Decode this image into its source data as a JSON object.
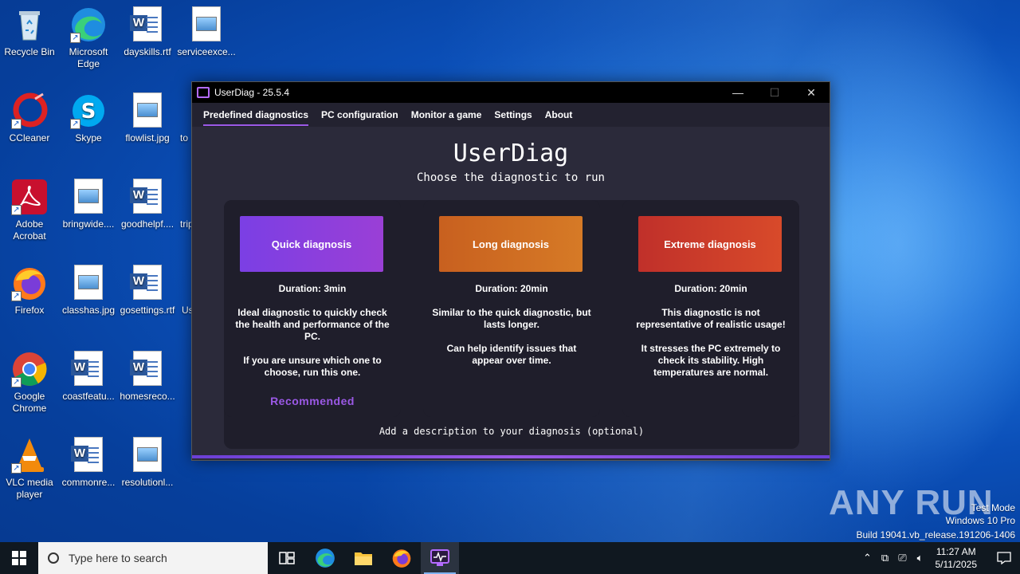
{
  "desktop": {
    "icons": [
      {
        "label": "Recycle Bin"
      },
      {
        "label": "Microsoft Edge"
      },
      {
        "label": "dayskills.rtf"
      },
      {
        "label": "serviceexce..."
      },
      {
        "label": "CCleaner"
      },
      {
        "label": "Skype"
      },
      {
        "label": "flowlist.jpg"
      },
      {
        "label": "to"
      },
      {
        "label": "Adobe Acrobat"
      },
      {
        "label": "bringwide...."
      },
      {
        "label": "goodhelpf...."
      },
      {
        "label": "trip"
      },
      {
        "label": "Firefox"
      },
      {
        "label": "classhas.jpg"
      },
      {
        "label": "gosettings.rtf"
      },
      {
        "label": "Us"
      },
      {
        "label": "Google Chrome"
      },
      {
        "label": "coastfeatu..."
      },
      {
        "label": "homesreco..."
      },
      {
        "label": "VLC media player"
      },
      {
        "label": "commonre..."
      },
      {
        "label": "resolutionl..."
      }
    ]
  },
  "window": {
    "title": "UserDiag - 25.5.4",
    "controls": {
      "minimize": "—",
      "maximize": "☐",
      "close": "✕"
    },
    "menu": [
      {
        "label": "Predefined diagnostics",
        "active": true
      },
      {
        "label": "PC configuration"
      },
      {
        "label": "Monitor a game"
      },
      {
        "label": "Settings"
      },
      {
        "label": "About"
      }
    ],
    "heading": "UserDiag",
    "subheading": "Choose the diagnostic to run",
    "cards": [
      {
        "button": "Quick diagnosis",
        "duration": "Duration: 3min",
        "desc1": "Ideal diagnostic to quickly check the health and performance of the PC.",
        "desc2": "If you are unsure which one to choose, run this one.",
        "badge": "Recommended",
        "color_start": "#7b3fe4",
        "color_end": "#9a3fd6"
      },
      {
        "button": "Long diagnosis",
        "duration": "Duration: 20min",
        "desc1": "Similar to the quick diagnostic, but lasts longer.",
        "desc2": "Can help identify issues that appear over time.",
        "color_start": "#c8601f",
        "color_end": "#d67a26"
      },
      {
        "button": "Extreme diagnosis",
        "duration": "Duration: 20min",
        "desc1": "This diagnostic is not representative of realistic usage!",
        "desc2": "It stresses the PC extremely to check its stability. High temperatures are normal.",
        "color_start": "#c0302a",
        "color_end": "#d84a2a"
      }
    ],
    "description_prompt": "Add a description to your diagnosis (optional)"
  },
  "watermark": {
    "logo": "ANY RUN",
    "line1": "Test Mode",
    "line2": "Windows 10 Pro",
    "line3": "Build 19041.vb_release.191206-1406"
  },
  "taskbar": {
    "search_placeholder": "Type here to search",
    "time": "11:27 AM",
    "date": "5/11/2025"
  }
}
